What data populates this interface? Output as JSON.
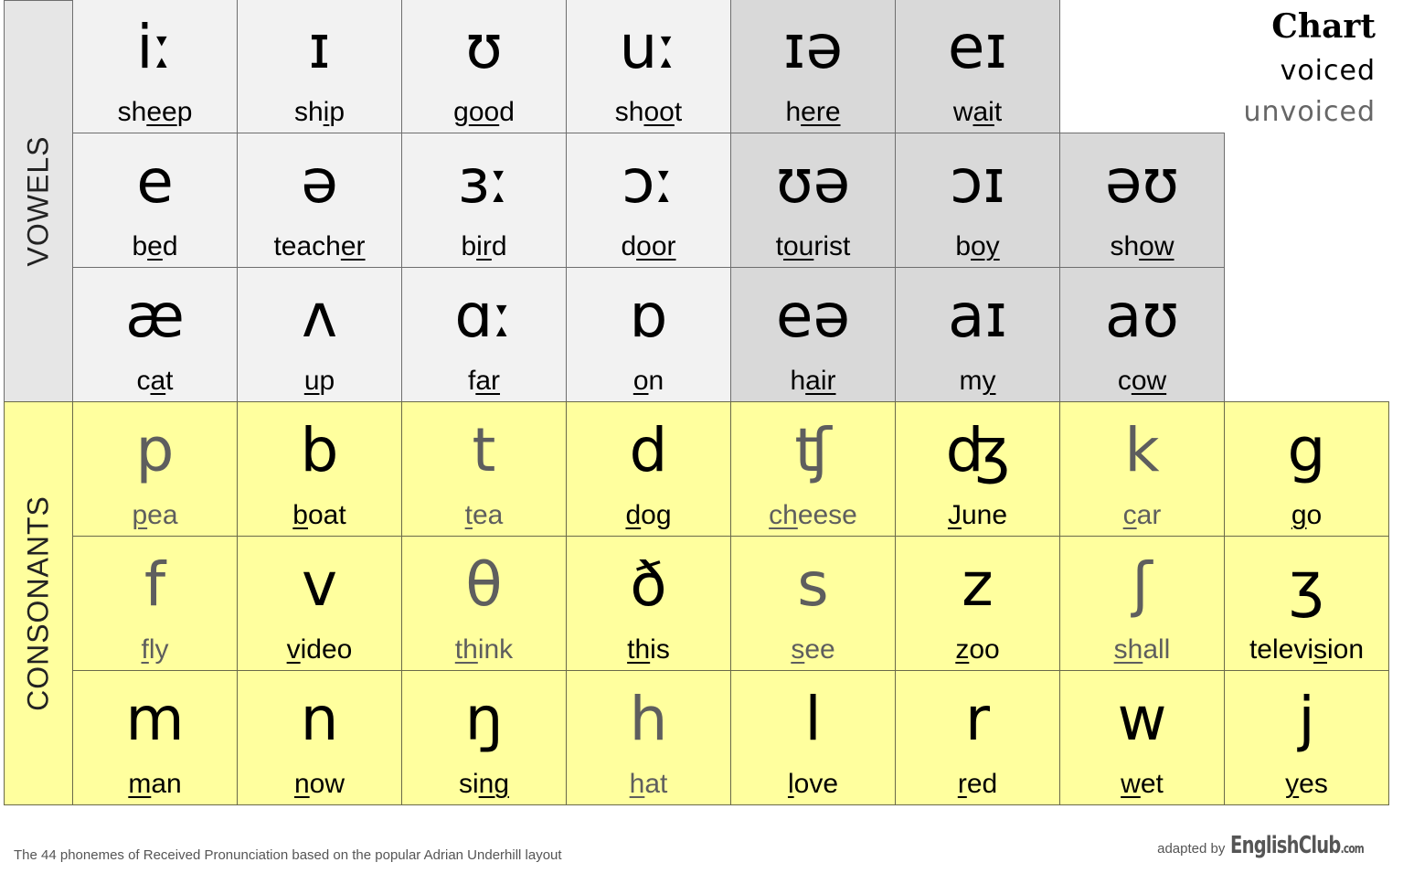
{
  "legend": {
    "title": "Chart",
    "voiced": "voiced",
    "unvoiced": "unvoiced"
  },
  "side_labels": {
    "vowels": "VOWELS",
    "consonants": "CONSONANTS"
  },
  "colors": {
    "monophthong_bg": "#f2f2f2",
    "diphthong_bg": "#d9d9d9",
    "consonant_bg": "#ffff9e",
    "vowel_label_bg": "#e6e6e6",
    "voiced_text": "#000000",
    "unvoiced_text": "#5e5e5e"
  },
  "vowels": [
    [
      {
        "symbol": "iː",
        "pre": "sh",
        "ul": "ee",
        "post": "p",
        "type": "mono"
      },
      {
        "symbol": "ɪ",
        "pre": "sh",
        "ul": "i",
        "post": "p",
        "type": "mono"
      },
      {
        "symbol": "ʊ",
        "pre": "g",
        "ul": "oo",
        "post": "d",
        "type": "mono"
      },
      {
        "symbol": "uː",
        "pre": "sh",
        "ul": "oo",
        "post": "t",
        "type": "mono"
      },
      {
        "symbol": "ɪə",
        "pre": "h",
        "ul": "ere",
        "post": "",
        "type": "diph"
      },
      {
        "symbol": "eɪ",
        "pre": "w",
        "ul": "ai",
        "post": "t",
        "type": "diph"
      }
    ],
    [
      {
        "symbol": "e",
        "pre": "b",
        "ul": "e",
        "post": "d",
        "type": "mono"
      },
      {
        "symbol": "ə",
        "pre": "teach",
        "ul": "er",
        "post": "",
        "type": "mono"
      },
      {
        "symbol": "ɜː",
        "pre": "b",
        "ul": "ir",
        "post": "d",
        "type": "mono"
      },
      {
        "symbol": "ɔː",
        "pre": "d",
        "ul": "oor",
        "post": "",
        "type": "mono"
      },
      {
        "symbol": "ʊə",
        "pre": "t",
        "ul": "ou",
        "post": "rist",
        "type": "diph"
      },
      {
        "symbol": "ɔɪ",
        "pre": "b",
        "ul": "oy",
        "post": "",
        "type": "diph"
      },
      {
        "symbol": "əʊ",
        "pre": "sh",
        "ul": "ow",
        "post": "",
        "type": "diph"
      }
    ],
    [
      {
        "symbol": "æ",
        "pre": "c",
        "ul": "a",
        "post": "t",
        "type": "mono"
      },
      {
        "symbol": "ʌ",
        "pre": "",
        "ul": "u",
        "post": "p",
        "type": "mono"
      },
      {
        "symbol": "ɑː",
        "pre": "f",
        "ul": "ar",
        "post": "",
        "type": "mono"
      },
      {
        "symbol": "ɒ",
        "pre": "",
        "ul": "o",
        "post": "n",
        "type": "mono"
      },
      {
        "symbol": "eə",
        "pre": "h",
        "ul": "air",
        "post": "",
        "type": "diph"
      },
      {
        "symbol": "aɪ",
        "pre": "m",
        "ul": "y",
        "post": "",
        "type": "diph"
      },
      {
        "symbol": "aʊ",
        "pre": "c",
        "ul": "ow",
        "post": "",
        "type": "diph"
      }
    ]
  ],
  "consonants": [
    [
      {
        "symbol": "p",
        "pre": "",
        "ul": "p",
        "post": "ea",
        "voiced": false
      },
      {
        "symbol": "b",
        "pre": "",
        "ul": "b",
        "post": "oat",
        "voiced": true
      },
      {
        "symbol": "t",
        "pre": "",
        "ul": "t",
        "post": "ea",
        "voiced": false
      },
      {
        "symbol": "d",
        "pre": "",
        "ul": "d",
        "post": "og",
        "voiced": true
      },
      {
        "symbol": "ʧ",
        "pre": "",
        "ul": "ch",
        "post": "eese",
        "voiced": false
      },
      {
        "symbol": "ʤ",
        "pre": "",
        "ul": "J",
        "post": "une",
        "voiced": true
      },
      {
        "symbol": "k",
        "pre": "",
        "ul": "c",
        "post": "ar",
        "voiced": false
      },
      {
        "symbol": "g",
        "pre": "",
        "ul": "g",
        "post": "o",
        "voiced": true
      }
    ],
    [
      {
        "symbol": "f",
        "pre": "",
        "ul": "f",
        "post": "ly",
        "voiced": false
      },
      {
        "symbol": "v",
        "pre": "",
        "ul": "v",
        "post": "ideo",
        "voiced": true
      },
      {
        "symbol": "θ",
        "pre": "",
        "ul": "th",
        "post": "ink",
        "voiced": false
      },
      {
        "symbol": "ð",
        "pre": "",
        "ul": "th",
        "post": "is",
        "voiced": true
      },
      {
        "symbol": "s",
        "pre": "",
        "ul": "s",
        "post": "ee",
        "voiced": false
      },
      {
        "symbol": "z",
        "pre": "",
        "ul": "z",
        "post": "oo",
        "voiced": true
      },
      {
        "symbol": "ʃ",
        "pre": "",
        "ul": "sh",
        "post": "all",
        "voiced": false
      },
      {
        "symbol": "ʒ",
        "pre": "televi",
        "ul": "s",
        "post": "ion",
        "voiced": true
      }
    ],
    [
      {
        "symbol": "m",
        "pre": "",
        "ul": "m",
        "post": "an",
        "voiced": true
      },
      {
        "symbol": "n",
        "pre": "",
        "ul": "n",
        "post": "ow",
        "voiced": true
      },
      {
        "symbol": "ŋ",
        "pre": "si",
        "ul": "ng",
        "post": "",
        "voiced": true
      },
      {
        "symbol": "h",
        "pre": "",
        "ul": "h",
        "post": "at",
        "voiced": false
      },
      {
        "symbol": "l",
        "pre": "",
        "ul": "l",
        "post": "ove",
        "voiced": true
      },
      {
        "symbol": "r",
        "pre": "",
        "ul": "r",
        "post": "ed",
        "voiced": true
      },
      {
        "symbol": "w",
        "pre": "",
        "ul": "w",
        "post": "et",
        "voiced": true
      },
      {
        "symbol": "j",
        "pre": "",
        "ul": "y",
        "post": "es",
        "voiced": true
      }
    ]
  ],
  "footer": {
    "caption": "The 44 phonemes of Received Pronunciation based on the popular Adrian Underhill layout",
    "credit_prefix": "adapted by",
    "brand": "EnglishClub",
    "brand_suffix": ".com"
  }
}
